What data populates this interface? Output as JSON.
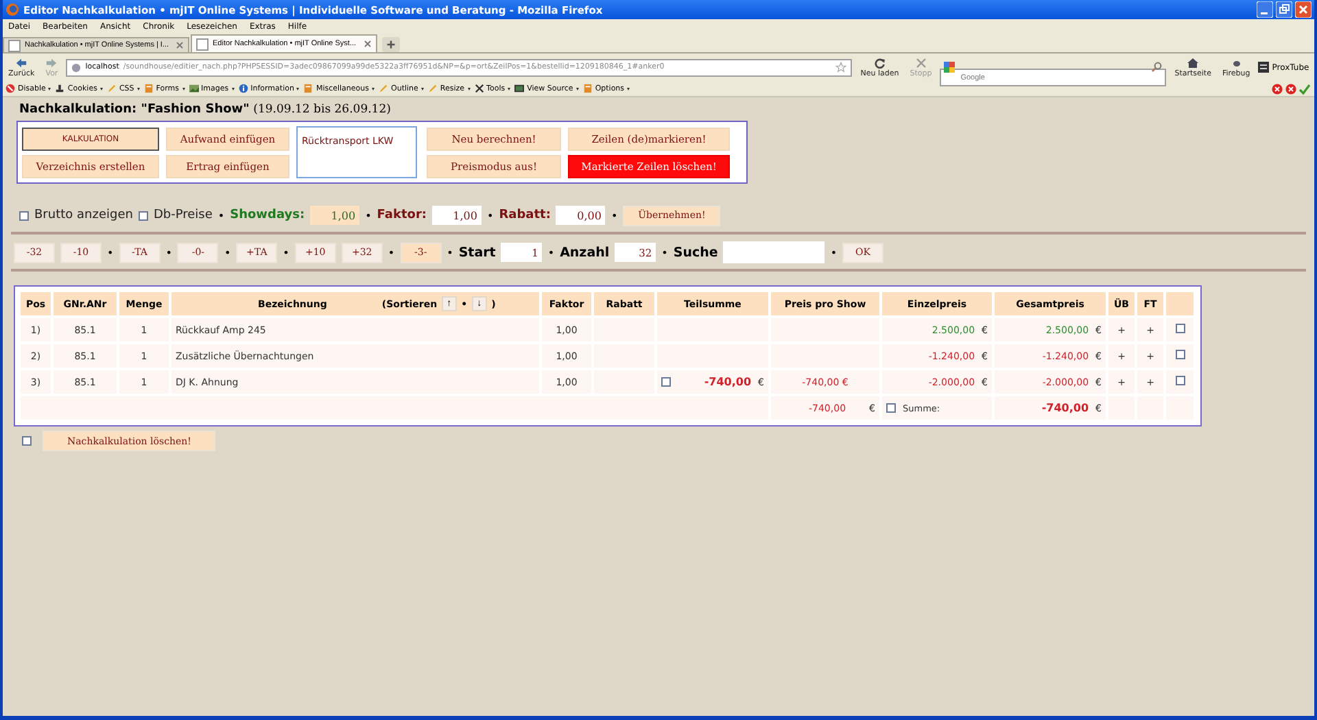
{
  "window": {
    "title": "Editor Nachkalkulation • mjIT Online Systems | Individuelle Software und Beratung - Mozilla Firefox"
  },
  "menu": [
    "Datei",
    "Bearbeiten",
    "Ansicht",
    "Chronik",
    "Lesezeichen",
    "Extras",
    "Hilfe"
  ],
  "tabs": [
    {
      "label": "Nachkalkulation • mjIT Online Systems | I...",
      "selected": false
    },
    {
      "label": "Editor Nachkalkulation • mjIT Online Syst...",
      "selected": true
    }
  ],
  "nav": {
    "back": "Zurück",
    "forward": "Vor",
    "url_host": "localhost",
    "url_path": "/soundhouse/editier_nach.php?PHPSESSID=3adec09867099a99de5322a3ff76951d&NP=&p=ort&ZeilPos=1&bestellid=1209180846_1#anker0",
    "reload": "Neu laden",
    "stop": "Stopp",
    "search_placeholder": "Google",
    "home": "Startseite",
    "firebug": "Firebug",
    "proxtube": "ProxTube"
  },
  "devbar": [
    "Disable",
    "Cookies",
    "CSS",
    "Forms",
    "Images",
    "Information",
    "Miscellaneous",
    "Outline",
    "Resize",
    "Tools",
    "View Source",
    "Options"
  ],
  "page": {
    "title": "Nachkalkulation: \"Fashion Show\"",
    "period": "(19.09.12 bis 26.09.12)",
    "left_buttons": [
      {
        "label": "KALKULATION",
        "kind": "mode"
      },
      {
        "label": "Aufwand einfügen",
        "kind": "action"
      },
      {
        "label": "Verzeichnis erstellen",
        "kind": "action"
      },
      {
        "label": "Ertrag einfügen",
        "kind": "action"
      }
    ],
    "note": "Rücktransport LKW",
    "right_buttons": [
      {
        "label": "Neu berechnen!",
        "kind": "action"
      },
      {
        "label": "Zeilen (de)markieren!",
        "kind": "action"
      },
      {
        "label": "Preismodus aus!",
        "kind": "action"
      },
      {
        "label": "Markierte Zeilen löschen!",
        "kind": "danger"
      }
    ],
    "options": [
      {
        "kind": "checkbox",
        "label": "Brutto anzeigen",
        "checked": false
      },
      {
        "kind": "checkbox",
        "label": "Db-Preise",
        "checked": false
      },
      {
        "kind": "sep",
        "text": "•"
      },
      {
        "kind": "label",
        "text": "Showdays:",
        "color": "#1e7a1e"
      },
      {
        "kind": "field",
        "value": "1,00",
        "highlighted": true
      },
      {
        "kind": "sep",
        "text": "•"
      },
      {
        "kind": "label",
        "text": "Faktor:",
        "color": "#7a1010"
      },
      {
        "kind": "field",
        "value": "1,00",
        "highlighted": false
      },
      {
        "kind": "sep",
        "text": "•"
      },
      {
        "kind": "label",
        "text": "Rabatt:",
        "color": "#7a1010"
      },
      {
        "kind": "field",
        "value": "0,00",
        "highlighted": false
      },
      {
        "kind": "sep",
        "text": "•"
      },
      {
        "kind": "button",
        "label": "Übernehmen!",
        "selected": true
      }
    ],
    "navigation": [
      {
        "kind": "button",
        "label": "-32",
        "selected": false
      },
      {
        "kind": "button",
        "label": "-10",
        "selected": false
      },
      {
        "kind": "sep",
        "text": "•"
      },
      {
        "kind": "button",
        "label": "-TA",
        "selected": false
      },
      {
        "kind": "sep",
        "text": "•"
      },
      {
        "kind": "button",
        "label": "-0-",
        "selected": false
      },
      {
        "kind": "sep",
        "text": "•"
      },
      {
        "kind": "button",
        "label": "+TA",
        "selected": false
      },
      {
        "kind": "sep",
        "text": "•"
      },
      {
        "kind": "button",
        "label": "+10",
        "selected": false
      },
      {
        "kind": "button",
        "label": "+32",
        "selected": false
      },
      {
        "kind": "sep",
        "text": "•"
      },
      {
        "kind": "button",
        "label": "-3-",
        "selected": true
      },
      {
        "kind": "sep",
        "text": "•"
      },
      {
        "kind": "label",
        "text": "Start",
        "color": "#000000"
      },
      {
        "kind": "field",
        "value": "1"
      },
      {
        "kind": "sep",
        "text": "•"
      },
      {
        "kind": "label",
        "text": "Anzahl",
        "color": "#000000"
      },
      {
        "kind": "field",
        "value": "32"
      },
      {
        "kind": "sep",
        "text": "•"
      },
      {
        "kind": "label",
        "text": "Suche",
        "color": "#000000"
      },
      {
        "kind": "search"
      },
      {
        "kind": "sep",
        "text": "•"
      },
      {
        "kind": "button",
        "label": "OK",
        "selected": false
      }
    ],
    "table": {
      "columns": [
        "Pos",
        "GNr.ANr",
        "Menge",
        "Bezeichnung",
        "Faktor",
        "Rabatt",
        "Teilsumme",
        "Preis pro Show",
        "Einzelpreis",
        "Gesamtpreis",
        "ÜB",
        "FT"
      ],
      "sort": {
        "label": "(Sortieren",
        "up": "↑",
        "sep": "•",
        "down": "↓",
        "close": ")"
      },
      "rows": [
        {
          "pos": "1)",
          "gnr": "85.1",
          "menge": "1",
          "bezeichnung": "Rückkauf Amp 245",
          "faktor": "1,00",
          "einzelpreis": {
            "value": "2.500,00",
            "currency": "€",
            "kind": "positive"
          },
          "gesamtpreis": {
            "value": "2.500,00",
            "currency": "€",
            "kind": "positive"
          },
          "ub": "+",
          "ft": "+",
          "checked": false
        },
        {
          "pos": "2)",
          "gnr": "85.1",
          "menge": "1",
          "bezeichnung": "Zusätzliche Übernachtungen",
          "faktor": "1,00",
          "einzelpreis": {
            "value": "-1.240,00",
            "currency": "€",
            "kind": "negative"
          },
          "gesamtpreis": {
            "value": "-1.240,00",
            "currency": "€",
            "kind": "negative"
          },
          "ub": "+",
          "ft": "+",
          "checked": false
        },
        {
          "pos": "3)",
          "gnr": "85.1",
          "menge": "1",
          "bezeichnung": "DJ K. Ahnung",
          "faktor": "1,00",
          "teilsumme": {
            "checked": false,
            "value": "-740,00",
            "currency": "€"
          },
          "preis_pro_show": "-740,00 €",
          "einzelpreis": {
            "value": "-2.000,00",
            "currency": "€",
            "kind": "negative"
          },
          "gesamtpreis": {
            "value": "-2.000,00",
            "currency": "€",
            "kind": "negative"
          },
          "ub": "+",
          "ft": "+",
          "checked": false
        }
      ],
      "summary": {
        "preis_pro_show": "-740,00",
        "currency": "€",
        "checked": false,
        "label": "Summe:",
        "total": "-740,00",
        "total_currency": "€"
      }
    },
    "delete": {
      "checked": false,
      "label": "Nachkalkulation löschen!"
    }
  }
}
